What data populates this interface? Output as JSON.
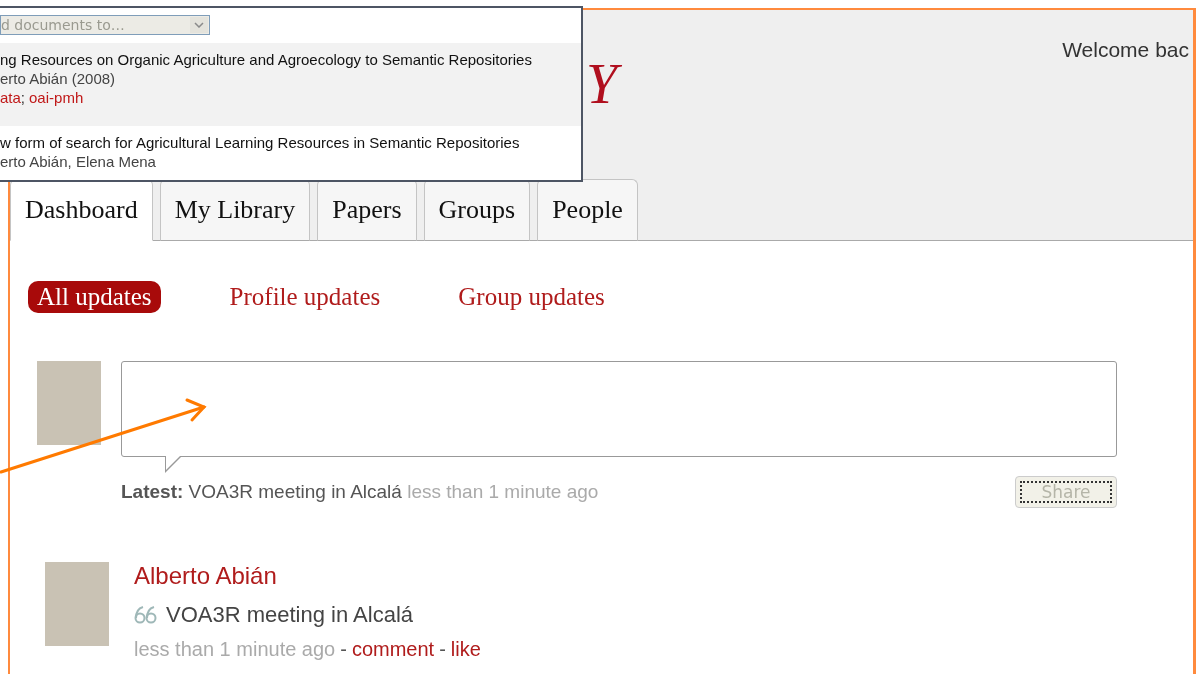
{
  "popup": {
    "select": {
      "value": "d documents to…"
    },
    "results": [
      {
        "title": "ng Resources on Organic Agriculture and Agroecology to Semantic Repositories",
        "authors": "erto Abián (2008)",
        "tags": [
          "ata",
          "oai-pmh"
        ],
        "tags_separator": ";",
        "selected": true
      },
      {
        "title": "w form of search for Agricultural Learning Resources in Semantic Repositories",
        "authors": "erto Abián, Elena Mena",
        "selected": false
      }
    ]
  },
  "header": {
    "logo_fragment": "Y",
    "welcome": "Welcome bac"
  },
  "tabs": [
    {
      "label": "Dashboard",
      "selected": true
    },
    {
      "label": "My Library",
      "selected": false
    },
    {
      "label": "Papers",
      "selected": false
    },
    {
      "label": "Groups",
      "selected": false
    },
    {
      "label": "People",
      "selected": false
    }
  ],
  "filters": [
    {
      "label": "All updates",
      "selected": true
    },
    {
      "label": "Profile updates",
      "selected": false
    },
    {
      "label": "Group updates",
      "selected": false
    }
  ],
  "composer": {
    "latest_label": "Latest:",
    "latest_text": "VOA3R meeting in Alcalá",
    "latest_time": "less than 1 minute ago",
    "share_button": {
      "label": "Share",
      "disabled": true
    }
  },
  "feed": [
    {
      "name": "Alberto Abián",
      "text": "VOA3R meeting in Alcalá",
      "time": "less than 1 minute ago",
      "separator_1": "-",
      "comment": "comment",
      "separator_2": "-",
      "like": "like"
    }
  ]
}
